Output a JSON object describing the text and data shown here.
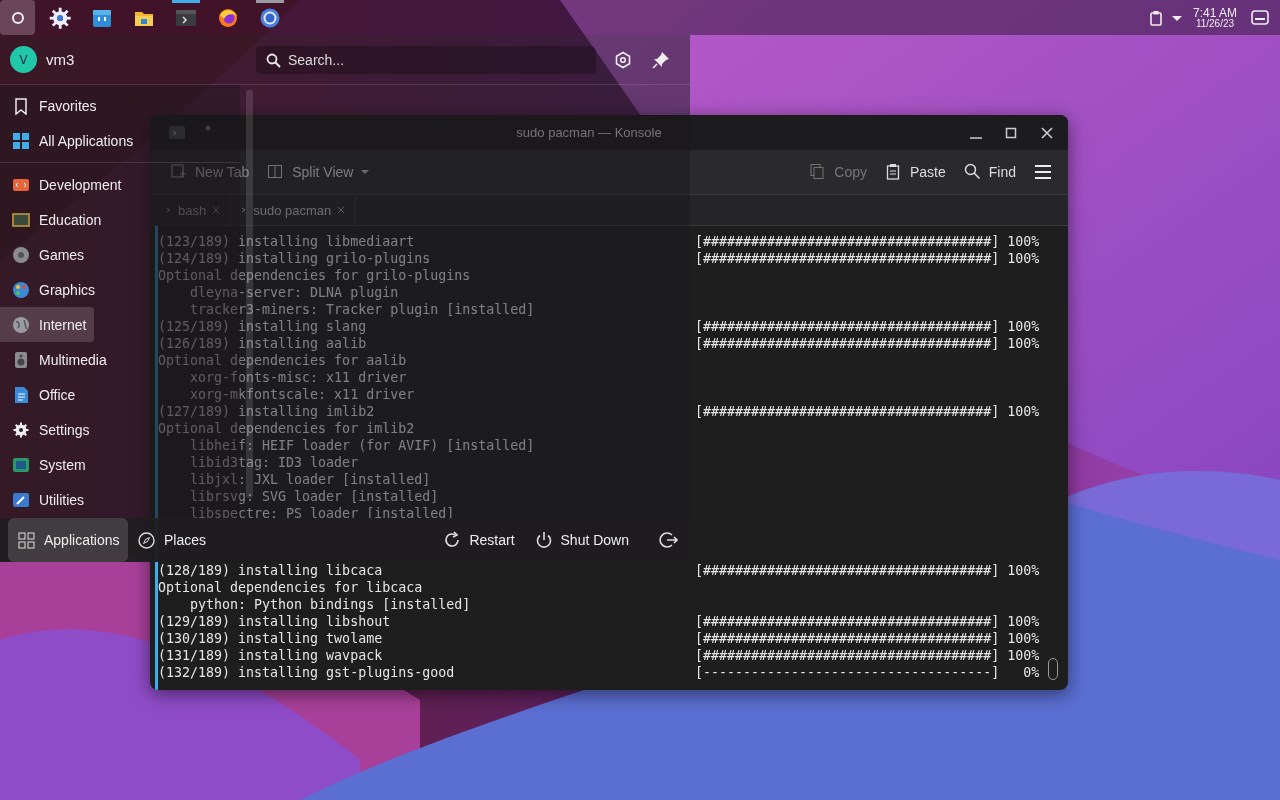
{
  "top_panel": {
    "items": [
      {
        "kind": "launcher",
        "selected": true,
        "open": false,
        "active": false
      },
      {
        "kind": "settings",
        "selected": false,
        "open": false,
        "active": false
      },
      {
        "kind": "store",
        "selected": false,
        "open": false,
        "active": false
      },
      {
        "kind": "files",
        "selected": false,
        "open": false,
        "active": false
      },
      {
        "kind": "terminal",
        "selected": false,
        "open": true,
        "active": true
      },
      {
        "kind": "browser",
        "selected": false,
        "open": false,
        "active": false
      },
      {
        "kind": "browser2",
        "selected": false,
        "open": true,
        "active": false
      }
    ],
    "time": "7:41 AM",
    "date": "11/26/23"
  },
  "terminal": {
    "title": "sudo pacman — Konsole",
    "toolbar_left": [
      {
        "kind": "new-tab",
        "label": "New Tab",
        "disabled": false
      },
      {
        "kind": "split",
        "label": "Split View",
        "disabled": false
      }
    ],
    "toolbar_right": [
      {
        "kind": "copy",
        "label": "Copy",
        "disabled": true
      },
      {
        "kind": "paste",
        "label": "Paste",
        "disabled": false
      },
      {
        "kind": "find",
        "label": "Find",
        "disabled": false
      },
      {
        "kind": "menu",
        "disabled": false
      }
    ],
    "tabs": [
      {
        "label": "bash"
      },
      {
        "label": "sudo pacman"
      }
    ],
    "lines_top": [
      {
        "text": "(123/189) installing libmediaart",
        "progress": "[####################################] 100%"
      },
      {
        "text": "(124/189) installing grilo-plugins",
        "progress": "[####################################] 100%"
      },
      {
        "text": "Optional dependencies for grilo-plugins"
      },
      {
        "text": "    dleyna-server: DLNA plugin"
      },
      {
        "text": "    tracker3-miners: Tracker plugin [installed]"
      },
      {
        "text": "(125/189) installing slang",
        "progress": "[####################################] 100%"
      },
      {
        "text": "(126/189) installing aalib",
        "progress": "[####################################] 100%"
      },
      {
        "text": "Optional dependencies for aalib"
      },
      {
        "text": "    xorg-fonts-misc: x11 driver"
      },
      {
        "text": "    xorg-mkfontscale: x11 driver"
      },
      {
        "text": "(127/189) installing imlib2",
        "progress": "[####################################] 100%"
      },
      {
        "text": "Optional dependencies for imlib2"
      },
      {
        "text": "    libheif: HEIF loader (for AVIF) [installed]"
      },
      {
        "text": "    libid3tag: ID3 loader"
      },
      {
        "text": "    libjxl: JXL loader [installed]"
      },
      {
        "text": "    librsvg: SVG loader [installed]"
      },
      {
        "text": "    libspectre: PS loader [installed]"
      }
    ],
    "lines_bottom": [
      {
        "text": "(128/189) installing libcaca",
        "progress": "[####################################] 100%"
      },
      {
        "text": "Optional dependencies for libcaca"
      },
      {
        "text": "    python: Python bindings [installed]"
      },
      {
        "text": "(129/189) installing libshout",
        "progress": "[####################################] 100%"
      },
      {
        "text": "(130/189) installing twolame",
        "progress": "[####################################] 100%"
      },
      {
        "text": "(131/189) installing wavpack",
        "progress": "[####################################] 100%"
      },
      {
        "text": "(132/189) installing gst-plugins-good",
        "progress": "[------------------------------------]   0%"
      }
    ]
  },
  "launcher": {
    "user": {
      "initial": "V",
      "name": "vm3"
    },
    "search": {
      "placeholder": "Search..."
    },
    "pinned": [
      {
        "kind": "favorites",
        "label": "Favorites",
        "selected": false
      },
      {
        "kind": "all",
        "label": "All Applications",
        "selected": false
      }
    ],
    "categories": [
      {
        "kind": "development",
        "label": "Development",
        "selected": false
      },
      {
        "kind": "education",
        "label": "Education",
        "selected": false
      },
      {
        "kind": "games",
        "label": "Games",
        "selected": false
      },
      {
        "kind": "graphics",
        "label": "Graphics",
        "selected": false
      },
      {
        "kind": "internet",
        "label": "Internet",
        "selected": true
      },
      {
        "kind": "multimedia",
        "label": "Multimedia",
        "selected": false
      },
      {
        "kind": "office",
        "label": "Office",
        "selected": false
      },
      {
        "kind": "settings",
        "label": "Settings",
        "selected": false
      },
      {
        "kind": "system",
        "label": "System",
        "selected": false
      },
      {
        "kind": "utilities",
        "label": "Utilities",
        "selected": false
      }
    ],
    "footer_tabs": [
      {
        "kind": "applications",
        "label": "Applications",
        "selected": true
      },
      {
        "kind": "places",
        "label": "Places",
        "selected": false
      }
    ],
    "actions": [
      {
        "kind": "restart",
        "label": "Restart"
      },
      {
        "kind": "shutdown",
        "label": "Shut Down"
      },
      {
        "kind": "logout"
      }
    ]
  }
}
